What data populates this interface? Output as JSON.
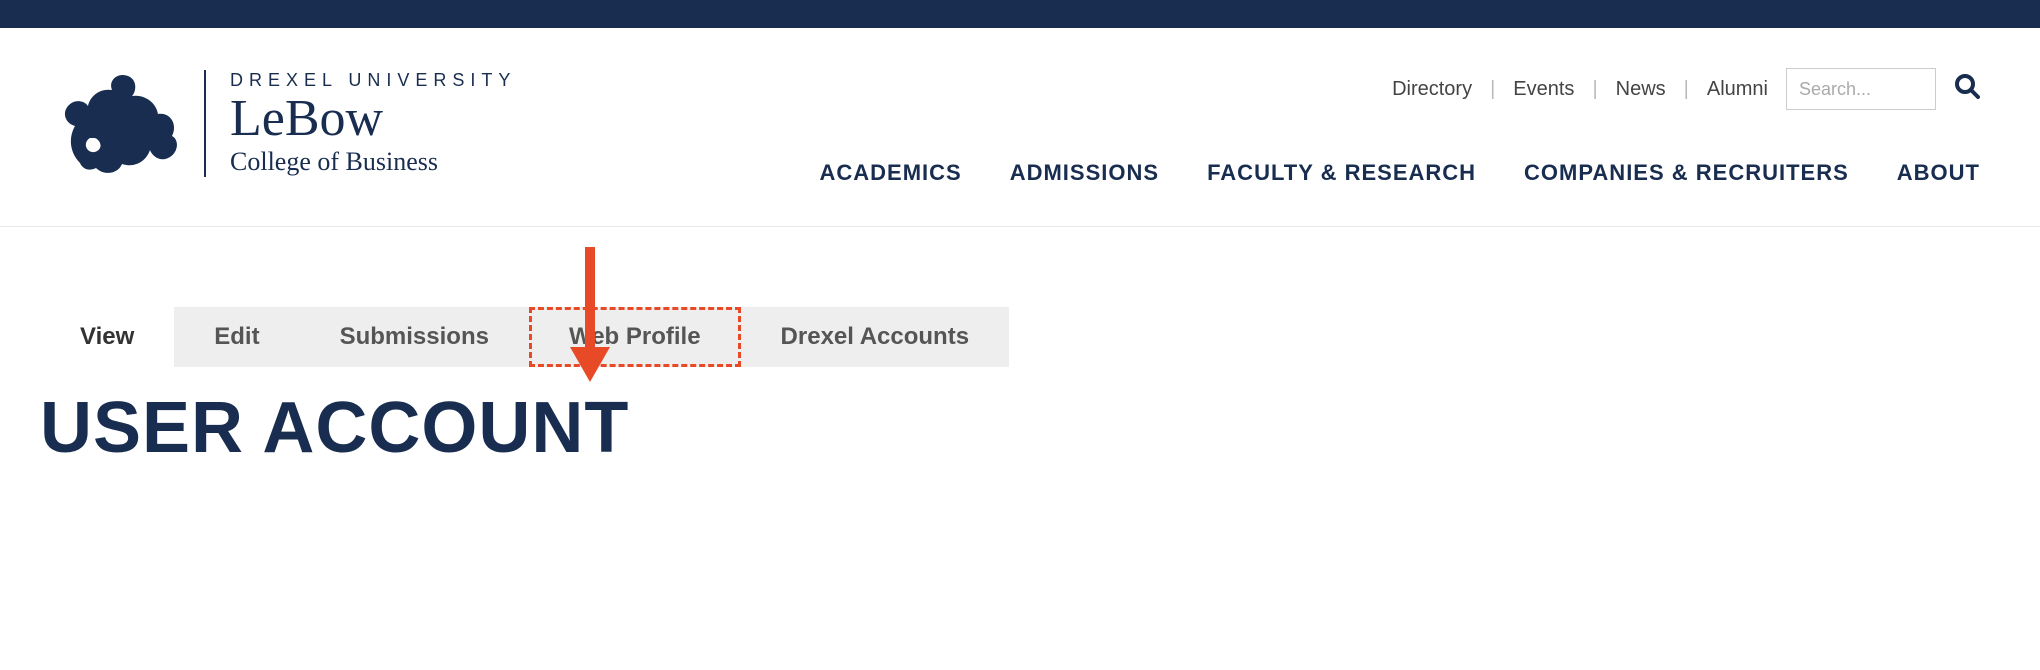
{
  "logo": {
    "university": "DREXEL UNIVERSITY",
    "name": "LeBow",
    "subtitle": "College of Business"
  },
  "utility_nav": {
    "directory": "Directory",
    "events": "Events",
    "news": "News",
    "alumni": "Alumni"
  },
  "search": {
    "placeholder": "Search..."
  },
  "main_nav": {
    "academics": "ACADEMICS",
    "admissions": "ADMISSIONS",
    "faculty": "FACULTY & RESEARCH",
    "companies": "COMPANIES & RECRUITERS",
    "about": "ABOUT"
  },
  "tabs": {
    "view": "View",
    "edit": "Edit",
    "submissions": "Submissions",
    "web_profile": "Web Profile",
    "drexel_accounts": "Drexel Accounts"
  },
  "page_title": "USER ACCOUNT"
}
